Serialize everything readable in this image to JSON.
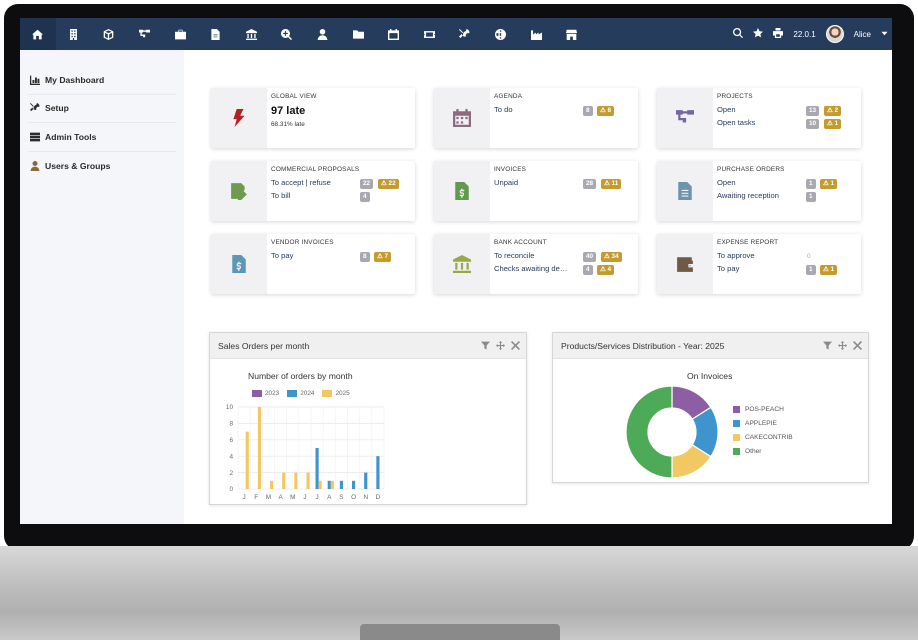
{
  "app": {
    "version": "22.0.1",
    "user": "Alice"
  },
  "nav_icons": [
    "home-icon",
    "building-icon",
    "cube-icon",
    "project-icon",
    "briefcase-icon",
    "file-invoice-icon",
    "bank-icon",
    "search-plus-icon",
    "user-tie-icon",
    "folder-icon",
    "calendar-icon",
    "ticket-icon",
    "tools-icon",
    "globe-icon",
    "industry-icon",
    "store-icon"
  ],
  "sidebar": {
    "items": [
      {
        "label": "My Dashboard",
        "icon": "chart-bar-icon"
      },
      {
        "label": "Setup",
        "icon": "tools-icon"
      },
      {
        "label": "Admin Tools",
        "icon": "server-icon"
      },
      {
        "label": "Users & Groups",
        "icon": "user-icon"
      }
    ]
  },
  "boxes": {
    "global": {
      "title": "GLOBAL VIEW",
      "big": "97 late",
      "small": "68.31% late"
    },
    "agenda": {
      "title": "AGENDA",
      "rows": [
        {
          "label": "To do",
          "count": "8",
          "late": "8"
        }
      ]
    },
    "projects": {
      "title": "PROJECTS",
      "rows": [
        {
          "label": "Open",
          "count": "13",
          "late": "2"
        },
        {
          "label": "Open tasks",
          "count": "10",
          "late": "1"
        }
      ]
    },
    "proposals": {
      "title": "COMMERCIAL PROPOSALS",
      "rows": [
        {
          "label": "To accept | refuse",
          "count": "22",
          "late": "22"
        },
        {
          "label": "To bill",
          "count": "4",
          "late": ""
        }
      ]
    },
    "invoices": {
      "title": "INVOICES",
      "rows": [
        {
          "label": "Unpaid",
          "count": "28",
          "late": "11"
        }
      ]
    },
    "purchase": {
      "title": "PURCHASE ORDERS",
      "rows": [
        {
          "label": "Open",
          "count": "1",
          "late": "1"
        },
        {
          "label": "Awaiting reception",
          "count": "1",
          "late": ""
        }
      ]
    },
    "vendor": {
      "title": "VENDOR INVOICES",
      "rows": [
        {
          "label": "To pay",
          "count": "8",
          "late": "7"
        }
      ]
    },
    "bank": {
      "title": "BANK ACCOUNT",
      "rows": [
        {
          "label": "To reconcile",
          "count": "40",
          "late": "34"
        },
        {
          "label": "Checks awaiting de…",
          "count": "4",
          "late": "4"
        }
      ]
    },
    "expense": {
      "title": "EXPENSE REPORT",
      "rows": [
        {
          "label": "To approve",
          "count": "0",
          "late": ""
        },
        {
          "label": "To pay",
          "count": "1",
          "late": "1"
        }
      ]
    }
  },
  "widgets": {
    "sales": {
      "title": "Sales Orders per month"
    },
    "products": {
      "title": "Products/Services Distribution - Year: 2025"
    }
  },
  "chart_data": [
    {
      "type": "bar",
      "title": "Number of orders by month",
      "categories": [
        "J",
        "F",
        "M",
        "A",
        "M",
        "J",
        "J",
        "A",
        "S",
        "O",
        "N",
        "D"
      ],
      "series": [
        {
          "name": "2023",
          "color": "#8e5ea2",
          "values": [
            0,
            0,
            0,
            0,
            0,
            0,
            0,
            0,
            0,
            0,
            0,
            0
          ]
        },
        {
          "name": "2024",
          "color": "#3e95cd",
          "values": [
            0,
            0,
            0,
            0,
            0,
            0,
            5,
            1,
            1,
            1,
            2,
            4
          ]
        },
        {
          "name": "2025",
          "color": "#f2c863",
          "values": [
            7,
            10,
            1,
            2,
            2,
            2,
            1,
            1,
            0,
            0,
            0,
            0
          ]
        }
      ],
      "ylim": [
        0,
        10
      ],
      "yticks": [
        0,
        2,
        4,
        6,
        8,
        10
      ],
      "grid": true,
      "legend": "top"
    },
    {
      "type": "pie",
      "title": "On Invoices",
      "labels": [
        "POS-PEACH",
        "APPLEPIE",
        "CAKECONTRIB",
        "Other"
      ],
      "values": [
        16,
        18,
        16,
        50
      ],
      "colors": [
        "#8e5ea2",
        "#3e95cd",
        "#f2c863",
        "#4daa57"
      ],
      "legend": "right"
    }
  ]
}
